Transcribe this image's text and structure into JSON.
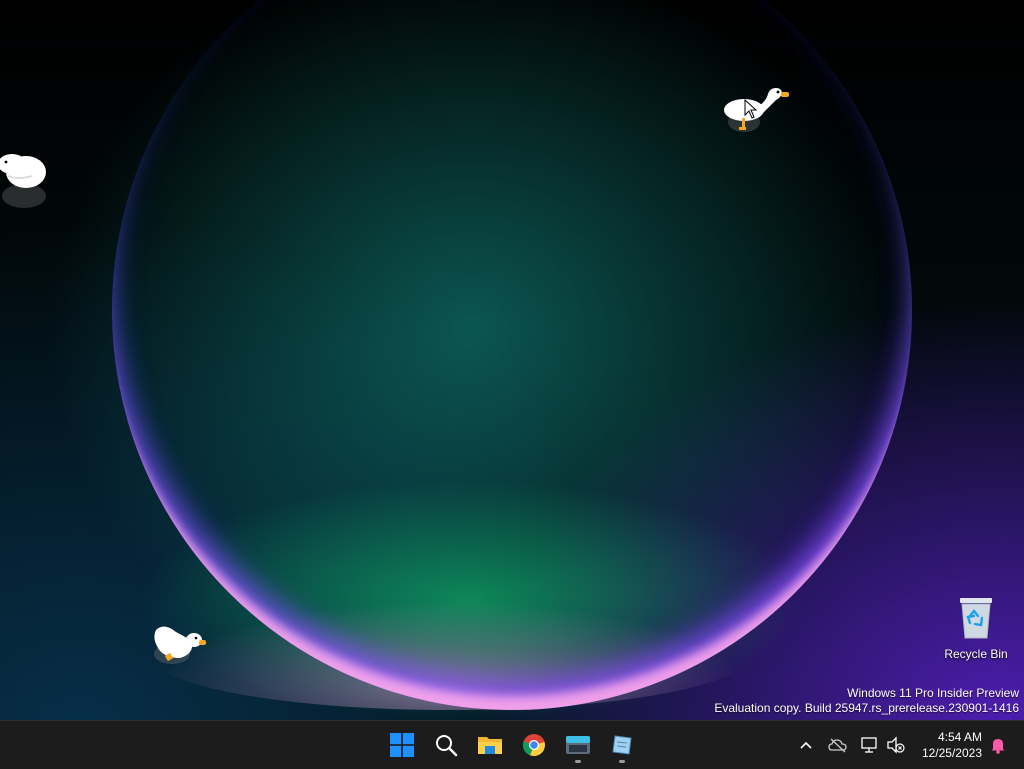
{
  "desktop": {
    "recycle_bin_label": "Recycle Bin",
    "watermark_line1": "Windows 11 Pro Insider Preview",
    "watermark_line2": "Evaluation copy. Build 25947.rs_prerelease.230901-1416"
  },
  "taskbar": {
    "apps": [
      {
        "name": "start-button",
        "icon": "windows-logo-icon"
      },
      {
        "name": "search-button",
        "icon": "search-icon"
      },
      {
        "name": "file-explorer-button",
        "icon": "folder-icon"
      },
      {
        "name": "chrome-button",
        "icon": "chrome-icon"
      },
      {
        "name": "terminal-app-button",
        "icon": "terminal-icon",
        "running": true
      },
      {
        "name": "notepad-app-button",
        "icon": "notepad-icon",
        "running": true
      }
    ],
    "tray": {
      "time": "4:54 AM",
      "date": "12/25/2023"
    }
  },
  "colors": {
    "taskbar_bg": "#1c1c1c",
    "windows_blue": "#1e90ff",
    "goose_beak": "#f5a623"
  }
}
